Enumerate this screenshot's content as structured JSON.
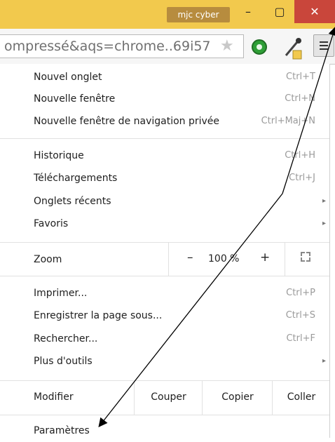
{
  "window": {
    "profile_name": "mjc cyber",
    "minimize_glyph": "–",
    "maximize_glyph": "▢",
    "close_glyph": "✕"
  },
  "toolbar": {
    "omnibox_text": "ompressé&aqs=chrome..69i57",
    "star_icon": "star-icon",
    "extension_icons": [
      "green-circle-extension-icon",
      "color-dropper-icon"
    ],
    "menu_icon": "hamburger-menu-icon"
  },
  "menu": {
    "group1": [
      {
        "label": "Nouvel onglet",
        "shortcut": "Ctrl+T"
      },
      {
        "label": "Nouvelle fenêtre",
        "shortcut": "Ctrl+N"
      },
      {
        "label": "Nouvelle fenêtre de navigation privée",
        "shortcut": "Ctrl+Maj+N"
      }
    ],
    "group2": [
      {
        "label": "Historique",
        "shortcut": "Ctrl+H"
      },
      {
        "label": "Téléchargements",
        "shortcut": "Ctrl+J"
      },
      {
        "label": "Onglets récents",
        "submenu": "▸"
      },
      {
        "label": "Favoris",
        "submenu": "▸"
      }
    ],
    "zoom": {
      "label": "Zoom",
      "minus": "–",
      "value": "100 %",
      "plus": "+"
    },
    "group3": [
      {
        "label": "Imprimer...",
        "shortcut": "Ctrl+P"
      },
      {
        "label": "Enregistrer la page sous...",
        "shortcut": "Ctrl+S"
      },
      {
        "label": "Rechercher...",
        "shortcut": "Ctrl+F"
      },
      {
        "label": "Plus d'outils",
        "submenu": "▸"
      }
    ],
    "edit": {
      "label": "Modifier",
      "cut": "Couper",
      "copy": "Copier",
      "paste": "Coller"
    },
    "settings": {
      "label": "Paramètres"
    }
  },
  "colors": {
    "titlebar": "#f2c94d",
    "close": "#c9463b",
    "profile_badge": "#b78c3e"
  }
}
